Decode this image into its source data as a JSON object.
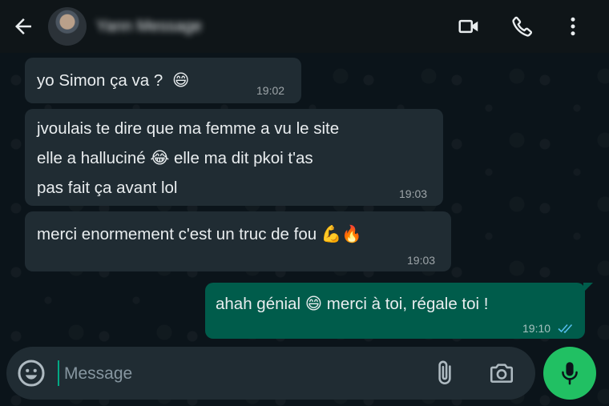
{
  "header": {
    "contact_name": "Yann Message",
    "icons": [
      "arrow-left-icon",
      "video-camera-icon",
      "phone-icon",
      "more-vertical-icon"
    ]
  },
  "messages": [
    {
      "direction": "in",
      "parts": [
        "yo Simon ça va ? ",
        "😄"
      ],
      "time": "19:02"
    },
    {
      "direction": "in",
      "lines": [
        "jvoulais te dire que ma femme a vu le site",
        "elle a halluciné 😂  elle ma dit pkoi t'as",
        "pas fait ça avant lol"
      ],
      "time": "19:03"
    },
    {
      "direction": "in",
      "parts": [
        "merci enormement c'est un truc de fou ",
        "💪🔥"
      ],
      "time": "19:03"
    },
    {
      "direction": "out",
      "parts": [
        "ahah génial ",
        "😄",
        " merci à toi, régale toi !"
      ],
      "time": "19:10",
      "status": "read"
    }
  ],
  "composer": {
    "placeholder": "Message",
    "value": ""
  },
  "colors": {
    "background": "#0b141a",
    "incoming_bubble": "#202c33",
    "outgoing_bubble": "#005c4b",
    "accent_green": "#21c063",
    "read_ticks": "#53bdeb"
  }
}
